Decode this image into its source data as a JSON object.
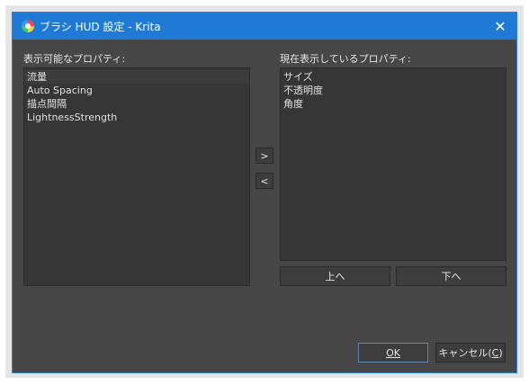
{
  "window": {
    "title": "ブラシ HUD 設定 - Krita",
    "close_glyph": "✕"
  },
  "available": {
    "label": "表示可能なプロパティ:",
    "items": [
      "流量",
      "Auto Spacing",
      "描点間隔",
      "LightnessStrength"
    ]
  },
  "current": {
    "label": "現在表示しているプロパティ:",
    "items": [
      "サイズ",
      "不透明度",
      "角度"
    ]
  },
  "buttons": {
    "add": ">",
    "remove": "<",
    "up": "上へ",
    "down": "下へ",
    "ok": "OK",
    "cancel_text": "キャンセル(",
    "cancel_key": "C",
    "cancel_close": ")"
  }
}
